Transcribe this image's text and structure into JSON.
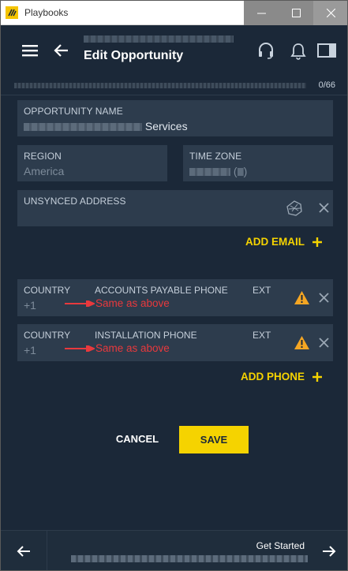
{
  "window": {
    "title": "Playbooks"
  },
  "header": {
    "title": "Edit Opportunity"
  },
  "progress": {
    "count": "0/66",
    "fraction": 0
  },
  "form": {
    "opportunity_name": {
      "label": "OPPORTUNITY NAME",
      "value_suffix": "Services"
    },
    "region": {
      "label": "REGION",
      "value": "America"
    },
    "time_zone": {
      "label": "TIME ZONE",
      "value": "(",
      "value_end": ")"
    },
    "unsynced_address": {
      "label": "UNSYNCED ADDRESS"
    },
    "add_email_label": "ADD EMAIL",
    "phones": [
      {
        "country_label": "COUNTRY",
        "country_code": "+1",
        "phone_label": "ACCOUNTS PAYABLE PHONE",
        "ext_label": "EXT",
        "note": "Same as above"
      },
      {
        "country_label": "COUNTRY",
        "country_code": "+1",
        "phone_label": "INSTALLATION PHONE",
        "ext_label": "EXT",
        "note": "Same as above"
      }
    ],
    "add_phone_label": "ADD PHONE"
  },
  "actions": {
    "cancel_label": "CANCEL",
    "save_label": "SAVE"
  },
  "footer": {
    "next_label": "Get Started"
  },
  "colors": {
    "accent": "#f5d300",
    "background": "#1b2838",
    "field": "#2d3c4d",
    "warning": "#f5a623",
    "annotation": "#e8393d"
  }
}
